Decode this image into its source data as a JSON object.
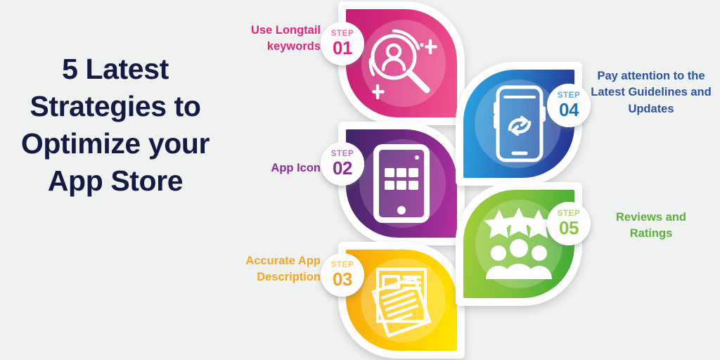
{
  "background": "#f0f1f1",
  "headline": {
    "text": "5 Latest Strategies to Optimize your App Store",
    "color": "#131b43"
  },
  "badge_word": "STEP",
  "steps": [
    {
      "number": "01",
      "label": "Use Longtail keywords",
      "icon": "magnifier-person-icon",
      "side": "left",
      "accent": "#e6217e",
      "text_color": "#e6217e",
      "gradient_from": "#c41f72",
      "gradient_to": "#f2558f",
      "halo": "rgba(255,255,255,0.20)"
    },
    {
      "number": "02",
      "label": "App Icon",
      "icon": "tablet-app-grid-icon",
      "side": "left",
      "accent": "#8d2a9c",
      "text_color": "#8d2a9c",
      "gradient_from": "#3f2566",
      "gradient_to": "#b72ea0",
      "halo": "rgba(255,255,255,0.18)"
    },
    {
      "number": "03",
      "label": "Accurate App Description",
      "icon": "documents-icon",
      "side": "left",
      "accent": "#f5a623",
      "text_color": "#f5a623",
      "gradient_from": "#f5a310",
      "gradient_to": "#ffe000",
      "halo": "rgba(255,255,255,0.26)"
    },
    {
      "number": "04",
      "label": "Pay attention to the Latest Guidelines and Updates",
      "icon": "phone-sync-icon",
      "side": "right",
      "accent": "#1b75bc",
      "text_color": "#2b52a3",
      "gradient_from": "#2ba6e0",
      "gradient_to": "#262a8c",
      "halo": "rgba(255,255,255,0.20)"
    },
    {
      "number": "05",
      "label": "Reviews and Ratings",
      "icon": "stars-people-icon",
      "side": "right",
      "accent": "#8cc63e",
      "text_color": "#5cb037",
      "gradient_from": "#a4cd39",
      "gradient_to": "#39a935",
      "halo": "rgba(255,255,255,0.22)"
    }
  ]
}
